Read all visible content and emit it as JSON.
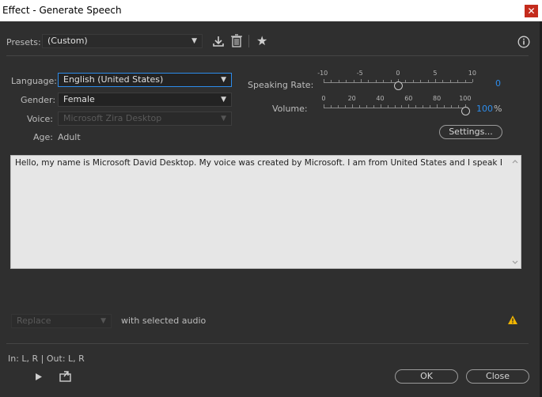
{
  "window": {
    "title": "Effect - Generate Speech",
    "close_glyph": "✕"
  },
  "toolbar": {
    "presets_label": "Presets:",
    "presets_value": "(Custom)",
    "save_icon": "download-icon",
    "delete_icon": "trash-icon",
    "favorite_icon": "star-icon",
    "info_icon": "info-icon"
  },
  "voice": {
    "language_label": "Language:",
    "language_value": "English (United States)",
    "gender_label": "Gender:",
    "gender_value": "Female",
    "voice_label": "Voice:",
    "voice_value": "Microsoft Zira Desktop",
    "age_label": "Age:",
    "age_value": "Adult"
  },
  "speaking_rate": {
    "label": "Speaking Rate:",
    "ticks": [
      "-10",
      "-5",
      "0",
      "5",
      "10"
    ],
    "value": "0",
    "level": 0
  },
  "volume": {
    "label": "Volume:",
    "ticks": [
      "0",
      "20",
      "40",
      "60",
      "80",
      "100"
    ],
    "value": "100",
    "unit": "%",
    "level": 100
  },
  "settings_button": "Settings...",
  "speech_text": "Hello, my name is Microsoft David Desktop. My voice was created by Microsoft. I am from United States and I speak English.",
  "replace": {
    "value": "Replace",
    "suffix": "with selected audio"
  },
  "warning_icon": "warning-icon",
  "io_text": "In: L, R | Out: L, R",
  "footer": {
    "ok": "OK",
    "close": "Close"
  },
  "colors": {
    "accent": "#2d8ceb",
    "background": "#2f2f2f",
    "warning": "#f2b600"
  }
}
